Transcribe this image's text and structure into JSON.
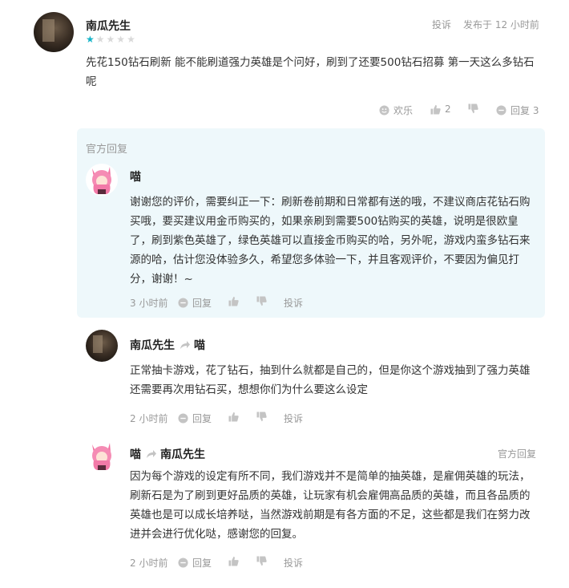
{
  "review": {
    "author": "南瓜先生",
    "stars": [
      "★",
      "★",
      "★",
      "★",
      "★"
    ],
    "rating": 1,
    "rating_max": 5,
    "report": "投诉",
    "time": "发布于 12 小时前",
    "text": "先花150钻石刷新 能不能刷道强力英雄是个问好，刷到了还要500钻石招募 第一天这么多钻石呢",
    "happy": "欢乐",
    "likes": "2",
    "replies": "回复 3"
  },
  "official": {
    "header": "官方回复",
    "author": "喵",
    "text": "谢谢您的评价，需要纠正一下：刷新卷前期和日常都有送的哦，不建议商店花钻石购买哦，要买建议用金币购买的，如果亲刷到需要500钻购买的英雄，说明是很欧皇了，刷到紫色英雄了，绿色英雄可以直接金币购买的哈，另外呢，游戏内蛮多钻石来源的哈，估计您没体验多久，希望您多体验一下，并且客观评价，不要因为偏见打分，谢谢！~",
    "time": "3 小时前",
    "reply": "回复",
    "report": "投诉"
  },
  "replies": [
    {
      "author": "南瓜先生",
      "to": "喵",
      "text": "正常抽卡游戏，花了钻石，抽到什么就都是自己的，但是你这个游戏抽到了强力英雄还需要再次用钻石买，想想你们为什么要这么设定",
      "time": "2 小时前",
      "reply": "回复",
      "report": "投诉"
    },
    {
      "author": "喵",
      "to": "南瓜先生",
      "badge": "官方回复",
      "text": "因为每个游戏的设定有所不同，我们游戏并不是简单的抽英雄，是雇佣英雄的玩法，刷新石是为了刷到更好品质的英雄，让玩家有机会雇佣高品质的英雄，而且各品质的英雄也是可以成长培养哒，当然游戏前期是有各方面的不足，这些都是我们在努力改进并会进行优化哒，感谢您的回复。",
      "time": "2 小时前",
      "reply": "回复",
      "report": "投诉"
    }
  ],
  "colors": {
    "star_on": "#15b4c8",
    "star_off": "#d9d9d9",
    "icon": "#c4c4c4",
    "official_bg": "#eef8fb"
  }
}
